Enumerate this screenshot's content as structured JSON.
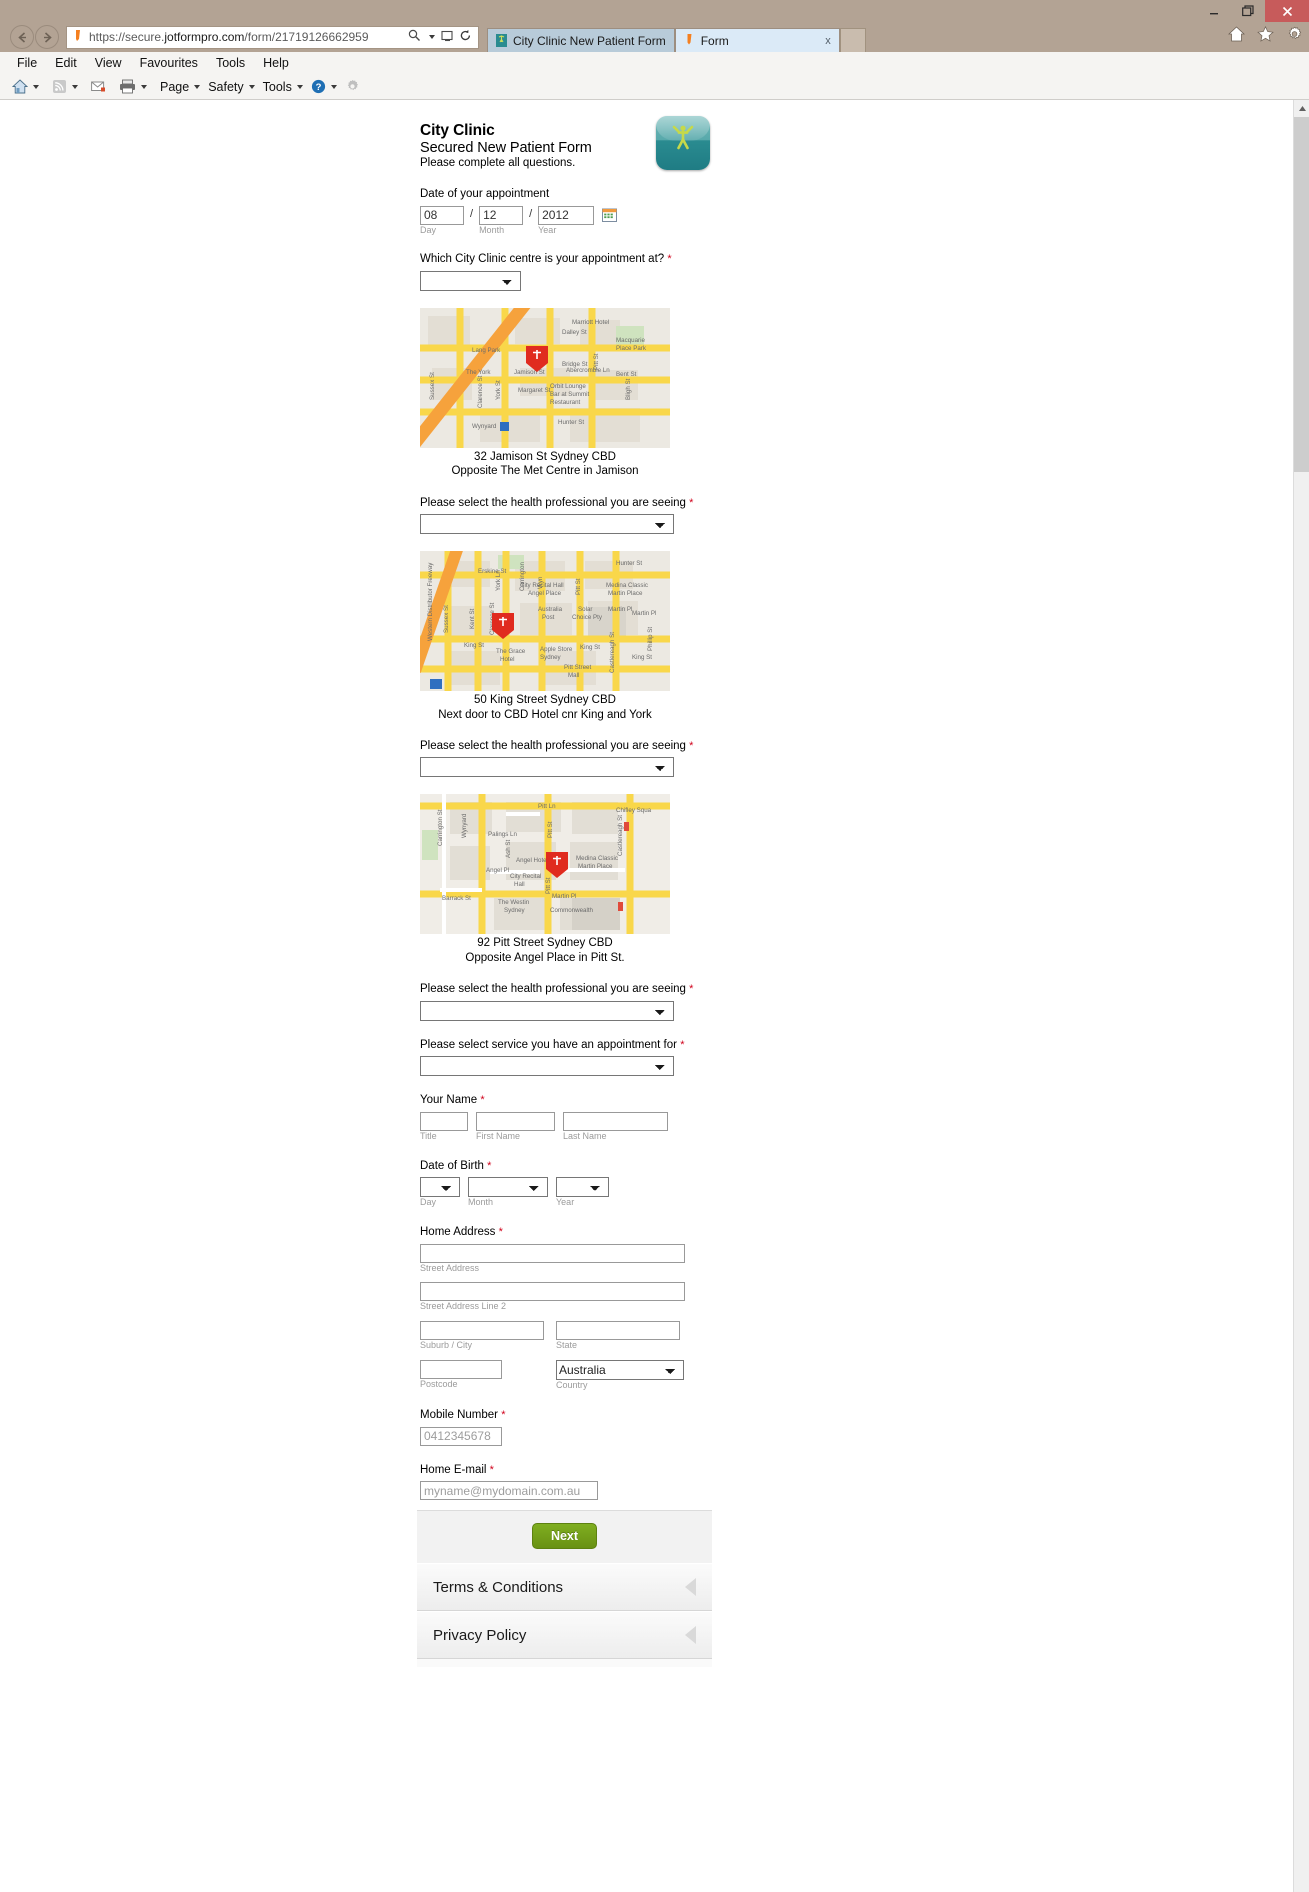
{
  "browser": {
    "address": "https://secure.jotformpro.com/form/21719126662959",
    "address_prefix": "https://secure.",
    "address_domain": "jotformpro.com",
    "address_suffix": "/form/21719126662959",
    "tabs": [
      {
        "label": "City Clinic New Patient Form",
        "active": false,
        "close": ""
      },
      {
        "label": "Form",
        "active": true,
        "close": "x"
      }
    ],
    "menu": [
      "File",
      "Edit",
      "View",
      "Favourites",
      "Tools",
      "Help"
    ],
    "command_bar": [
      "Page",
      "Safety",
      "Tools"
    ],
    "window_controls": {
      "minimize": "–",
      "restore": "❐",
      "close": "✕"
    },
    "icons": {
      "back": "back-arrow-icon",
      "forward": "forward-arrow-icon",
      "search": "search-icon",
      "compat": "compatibility-view-icon",
      "refresh": "refresh-icon",
      "home": "home-icon",
      "favorites": "star-icon",
      "settings": "gear-icon",
      "feeds": "rss-icon",
      "mail": "mail-icon",
      "print": "print-icon",
      "help": "help-icon"
    }
  },
  "form": {
    "title": "City Clinic",
    "subtitle": "Secured New Patient Form",
    "note": "Please complete all questions.",
    "logo_alt": "city-clinic-logo",
    "appointment_date": {
      "label": "Date of your appointment",
      "day": "08",
      "month": "12",
      "year": "2012",
      "day_sub": "Day",
      "month_sub": "Month",
      "year_sub": "Year",
      "separator": "/",
      "calendar_icon": "calendar-icon"
    },
    "centre_question": {
      "label": "Which City Clinic centre is your appointment at?",
      "required_marker": "*",
      "value": ""
    },
    "locations": [
      {
        "address_line1": "32 Jamison St Sydney CBD",
        "address_line2": "Opposite The Met Centre in Jamison",
        "map_alt": "map-jamison-st",
        "professional_label": "Please select the health professional you are seeing",
        "professional_value": ""
      },
      {
        "address_line1": "50 King Street Sydney CBD",
        "address_line2": "Next door to CBD Hotel cnr King and York",
        "map_alt": "map-king-street",
        "professional_label": "Please select the health professional you are seeing",
        "professional_value": ""
      },
      {
        "address_line1": "92 Pitt Street Sydney CBD",
        "address_line2": "Opposite Angel Place in Pitt St.",
        "map_alt": "map-pitt-street",
        "professional_label": "Please select the health professional you are seeing",
        "professional_value": ""
      }
    ],
    "service_question": {
      "label": "Please select service you have an appointment for",
      "required_marker": "*",
      "value": ""
    },
    "your_name": {
      "label": "Your Name",
      "required_marker": "*",
      "title_value": "",
      "first_value": "",
      "last_value": "",
      "title_sub": "Title",
      "first_sub": "First Name",
      "last_sub": "Last Name"
    },
    "date_of_birth": {
      "label": "Date of Birth",
      "required_marker": "*",
      "day_value": "",
      "month_value": "",
      "year_value": "",
      "day_sub": "Day",
      "month_sub": "Month",
      "year_sub": "Year"
    },
    "home_address": {
      "label": "Home Address",
      "required_marker": "*",
      "street_value": "",
      "street_sub": "Street Address",
      "street2_value": "",
      "street2_sub": "Street Address Line 2",
      "suburb_value": "",
      "suburb_sub": "Suburb / City",
      "state_value": "",
      "state_sub": "State",
      "postcode_value": "",
      "postcode_sub": "Postcode",
      "country_value": "Australia",
      "country_sub": "Country"
    },
    "mobile": {
      "label": "Mobile Number",
      "required_marker": "*",
      "placeholder": "0412345678",
      "value": ""
    },
    "email": {
      "label": "Home E-mail",
      "required_marker": "*",
      "placeholder": "myname@mydomain.com.au",
      "value": ""
    },
    "next_button": "Next",
    "accordion": [
      {
        "label": "Terms & Conditions",
        "arrow": "collapse-arrow-icon"
      },
      {
        "label": "Privacy Policy",
        "arrow": "collapse-arrow-icon"
      }
    ]
  },
  "colors": {
    "chrome": "#b3a394",
    "close_button": "#c75b5b",
    "active_tab": "#dbeaf7",
    "inactive_tab": "#b8cbd9",
    "next_button": "#7fae20",
    "required": "#d0021b",
    "logo_teal": "#2a8b90",
    "logo_figure": "#c6d94a"
  }
}
